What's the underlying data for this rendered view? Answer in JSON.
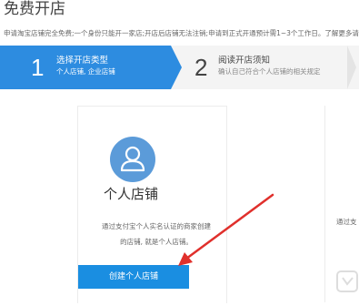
{
  "page": {
    "title": "免费开店",
    "notice": "申请淘宝店铺完全免费;一个身份只能开一家店;开店后店铺无法注销;申请到正式开通预计需1~3个工作日。了解更多请看"
  },
  "steps": [
    {
      "number": "1",
      "title": "选择开店类型",
      "subtitle": "个人店铺, 企业店铺",
      "active": true
    },
    {
      "number": "2",
      "title": "阅读开店须知",
      "subtitle": "确认自己符合个人店铺的相关规定",
      "active": false
    }
  ],
  "card": {
    "icon": "person-icon",
    "title": "个人店铺",
    "desc_line1": "通过支付宝个人实名认证的商家创建",
    "desc_line2": "的店铺, 就是个人店铺。",
    "button": "创建个人店铺"
  },
  "card_right": {
    "desc_partial": "通过支"
  },
  "colors": {
    "accent": "#2d8ce0",
    "button": "#1a8ee1",
    "avatar": "#5b9bd9",
    "arrow": "#e0302c"
  }
}
